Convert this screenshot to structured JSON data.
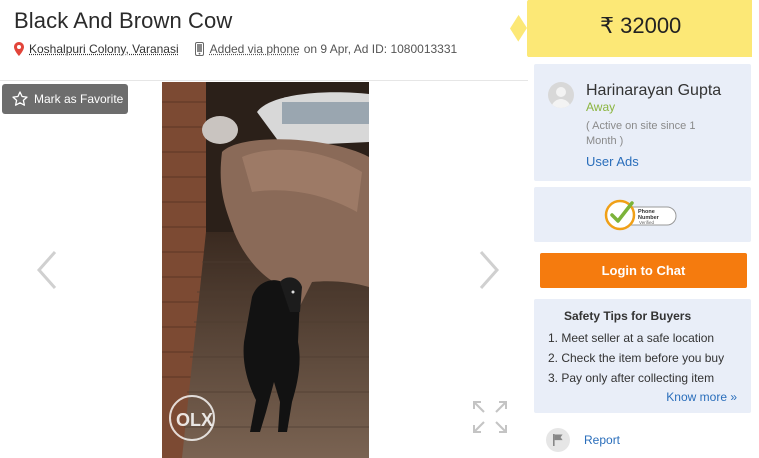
{
  "ad": {
    "title": "Black And Brown Cow",
    "location": "Koshalpuri Colony, Varanasi",
    "added_via": "Added via phone",
    "date_id": "on 9 Apr, Ad ID: 1080013331",
    "price": "₹ 32000"
  },
  "gallery": {
    "favorite_label": "Mark as Favorite",
    "watermark": "OLX"
  },
  "seller": {
    "name": "Harinarayan Gupta",
    "status": "Away",
    "since": "( Active on site since 1 Month )",
    "user_ads": "User Ads",
    "badge_text": "Phone Number Verified"
  },
  "chat": {
    "label": "Login to Chat"
  },
  "safety": {
    "title": "Safety Tips for Buyers",
    "tips": [
      "1. Meet seller at a safe location",
      "2. Check the item before you buy",
      "3. Pay only after collecting item"
    ],
    "know_more": "Know more »"
  },
  "report": {
    "label": "Report"
  },
  "colors": {
    "price_bg": "#fce876",
    "chat_bg": "#f57b0e",
    "panel_bg": "#e9eef8",
    "link": "#2a6ebb",
    "status": "#8bb53f"
  }
}
